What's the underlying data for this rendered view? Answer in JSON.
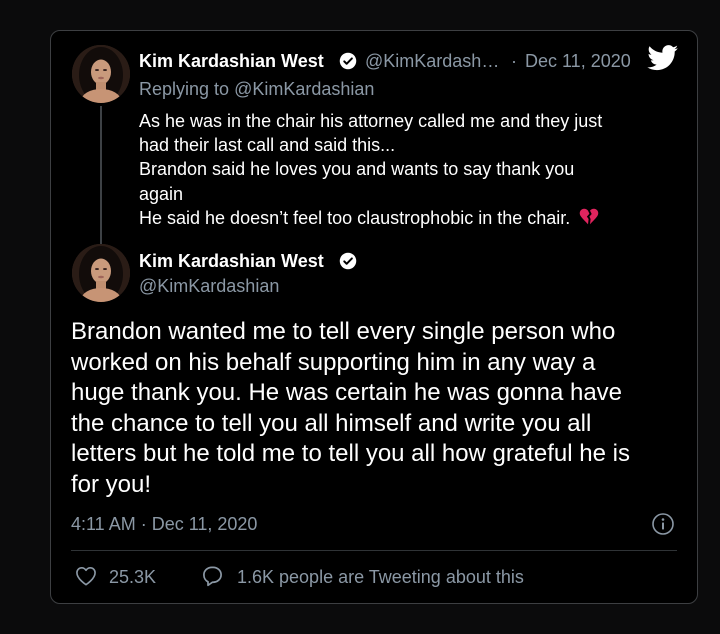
{
  "quoted_tweet": {
    "author_name": "Kim Kardashian West",
    "handle": "@KimKardash…",
    "separator": "·",
    "date": "Dec 11, 2020",
    "replying_prefix": "Replying to ",
    "replying_handle": "@KimKardashian",
    "lines": [
      "As he was in the chair his attorney called me and they just",
      "had their last call and said this...",
      "Brandon said he loves you and wants to say thank you",
      "again",
      "He said he doesn’t feel too claustrophobic in the chair."
    ],
    "emoji_name": "broken-heart-emoji"
  },
  "main_tweet": {
    "author_name": "Kim Kardashian West",
    "handle": "@KimKardashian",
    "lines": [
      "Brandon wanted me to tell every single person who",
      "worked on his behalf supporting him in any way a",
      "huge thank you. He was certain he was gonna have",
      "the chance to tell you all himself and write you all",
      "letters but he told me to tell you all how grateful he is",
      "for you!"
    ],
    "timestamp": "4:11 AM · Dec 11, 2020",
    "likes": "25.3K",
    "conversation": "1.6K people are Tweeting about this"
  },
  "colors": {
    "background": "#000000",
    "muted": "#8b98a5",
    "twitter_blue": "#1d9bf0",
    "broken_heart": "#e0245e"
  },
  "icons": {
    "verified": "verified-badge-icon",
    "bird": "twitter-bird-icon",
    "info": "info-icon",
    "like": "heart-icon",
    "reply": "speech-bubble-icon"
  }
}
